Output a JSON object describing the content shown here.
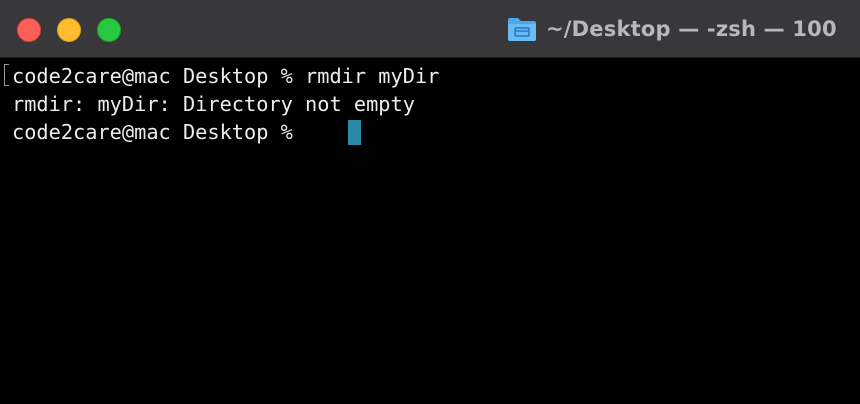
{
  "window": {
    "title": "~/Desktop — -zsh — 100",
    "title_icon": "folder-icon",
    "buttons": {
      "close": "close-window",
      "minimize": "minimize-window",
      "zoom": "zoom-window"
    },
    "colors": {
      "titlebar": "#38383b",
      "close": "#fe5f57",
      "minimize": "#febc2e",
      "zoom": "#28c840",
      "title_text": "#b8b8bc",
      "folder": "#4aa7e8"
    }
  },
  "terminal": {
    "lines": [
      "code2care@mac Desktop % rmdir myDir",
      "rmdir: myDir: Directory not empty",
      "code2care@mac Desktop % "
    ],
    "colors": {
      "background": "#000000",
      "text": "#ececec",
      "cursor": "#2a88a8"
    }
  }
}
